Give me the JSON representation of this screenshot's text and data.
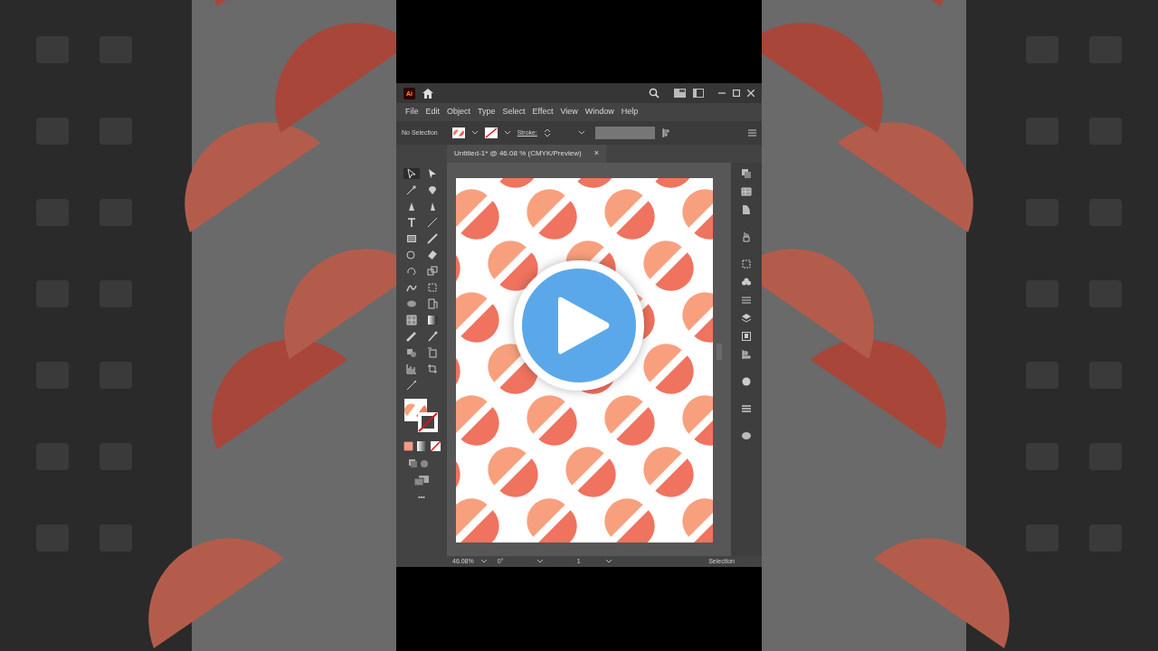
{
  "app": {
    "logo": "Ai"
  },
  "menu": [
    "File",
    "Edit",
    "Object",
    "Type",
    "Select",
    "Effect",
    "View",
    "Window",
    "Help"
  ],
  "control_bar": {
    "selection": "No Selection",
    "stroke_label": "Stroke:"
  },
  "document_tab": {
    "title": "Untitled-1* @ 46.08 % (CMYK/Preview)",
    "close": "×"
  },
  "tools": [
    {
      "selected": true
    },
    {
      "selected": false
    },
    {
      "selected": false
    },
    {
      "selected": false
    },
    {
      "selected": false
    },
    {
      "selected": false
    },
    {
      "selected": false
    },
    {
      "selected": false
    },
    {
      "selected": false
    },
    {
      "selected": false
    },
    {
      "selected": false
    },
    {
      "selected": false
    },
    {
      "selected": false
    },
    {
      "selected": false
    },
    {
      "selected": false
    },
    {
      "selected": false
    },
    {
      "selected": false
    },
    {
      "selected": false
    },
    {
      "selected": false
    },
    {
      "selected": false
    },
    {
      "selected": false
    },
    {
      "selected": false
    },
    {
      "selected": false
    },
    {
      "selected": false
    },
    {
      "selected": false
    },
    {
      "selected": false
    },
    {
      "selected": false
    }
  ],
  "more_tools": "•••",
  "status_bar": {
    "zoom": "46.08%",
    "rotation": "0°",
    "artboard": "1",
    "tool": "Selection"
  }
}
